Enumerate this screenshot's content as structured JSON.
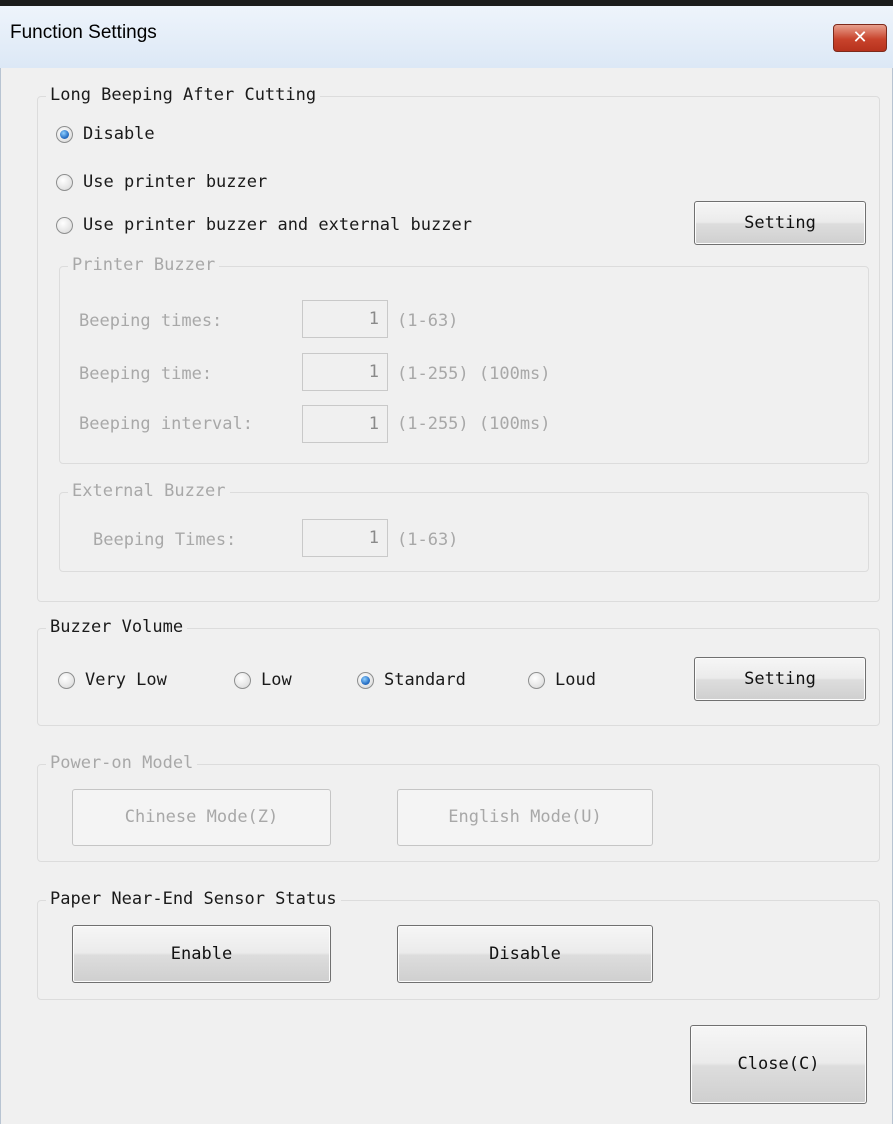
{
  "window": {
    "title": "Function Settings",
    "close_glyph": "✕"
  },
  "long_beeping": {
    "title": "Long Beeping After Cutting",
    "options": [
      {
        "label": "Disable",
        "checked": true
      },
      {
        "label": "Use printer buzzer",
        "checked": false
      },
      {
        "label": "Use printer buzzer and external buzzer",
        "checked": false
      }
    ],
    "setting_label": "Setting",
    "printer_buzzer": {
      "title": "Printer Buzzer",
      "rows": [
        {
          "label": "Beeping times:",
          "value": "1",
          "range": "(1-63)"
        },
        {
          "label": "Beeping time:",
          "value": "1",
          "range": "(1-255) (100ms)"
        },
        {
          "label": "Beeping interval:",
          "value": "1",
          "range": "(1-255) (100ms)"
        }
      ]
    },
    "external_buzzer": {
      "title": "External Buzzer",
      "rows": [
        {
          "label": "Beeping Times:",
          "value": "1",
          "range": "(1-63)"
        }
      ]
    }
  },
  "buzzer_volume": {
    "title": "Buzzer Volume",
    "options": [
      {
        "label": "Very Low",
        "checked": false
      },
      {
        "label": "Low",
        "checked": false
      },
      {
        "label": "Standard",
        "checked": true
      },
      {
        "label": "Loud",
        "checked": false
      }
    ],
    "setting_label": "Setting"
  },
  "power_on": {
    "title": "Power-on Model",
    "chinese_label": "Chinese Mode(Z)",
    "english_label": "English Mode(U)"
  },
  "paper_sensor": {
    "title": "Paper Near-End Sensor Status",
    "enable_label": "Enable",
    "disable_label": "Disable"
  },
  "close_label": "Close(C)"
}
